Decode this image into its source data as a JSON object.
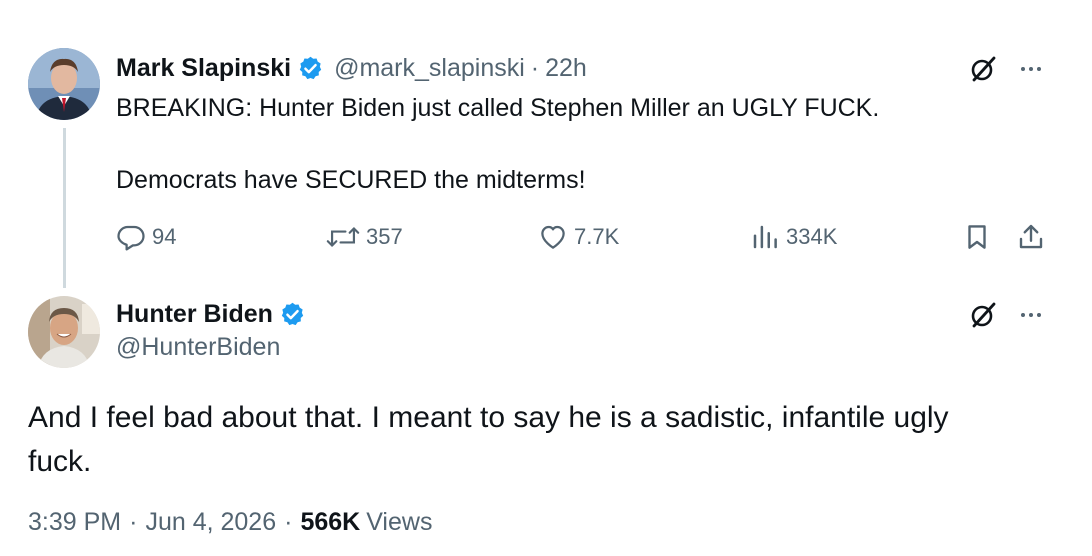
{
  "parent_tweet": {
    "author_name": "Mark Slapinski",
    "handle": "@mark_slapinski",
    "separator": "·",
    "time_ago": "22h",
    "text_line1": "BREAKING: Hunter Biden just called Stephen Miller an UGLY FUCK.",
    "text_line2": "Democrats have SECURED the midterms!",
    "actions": {
      "replies": "94",
      "retweets": "357",
      "likes": "7.7K",
      "views": "334K"
    }
  },
  "reply_tweet": {
    "author_name": "Hunter Biden",
    "handle": "@HunterBiden",
    "text": "And I feel bad about that. I meant to say he is a sadistic, infantile ugly fuck.",
    "timestamp": "3:39 PM",
    "separator": "·",
    "date": "Jun 4, 2026",
    "views_count": "566K",
    "views_label": "Views"
  },
  "colors": {
    "verified_blue": "#1d9bf0",
    "secondary_text": "#536471",
    "primary_text": "#0f1419",
    "thread_line": "#cfd9de"
  },
  "icons": [
    "verified-badge-icon",
    "grok-icon",
    "more-icon",
    "reply-icon",
    "retweet-icon",
    "like-icon",
    "views-icon",
    "bookmark-icon",
    "share-icon"
  ]
}
